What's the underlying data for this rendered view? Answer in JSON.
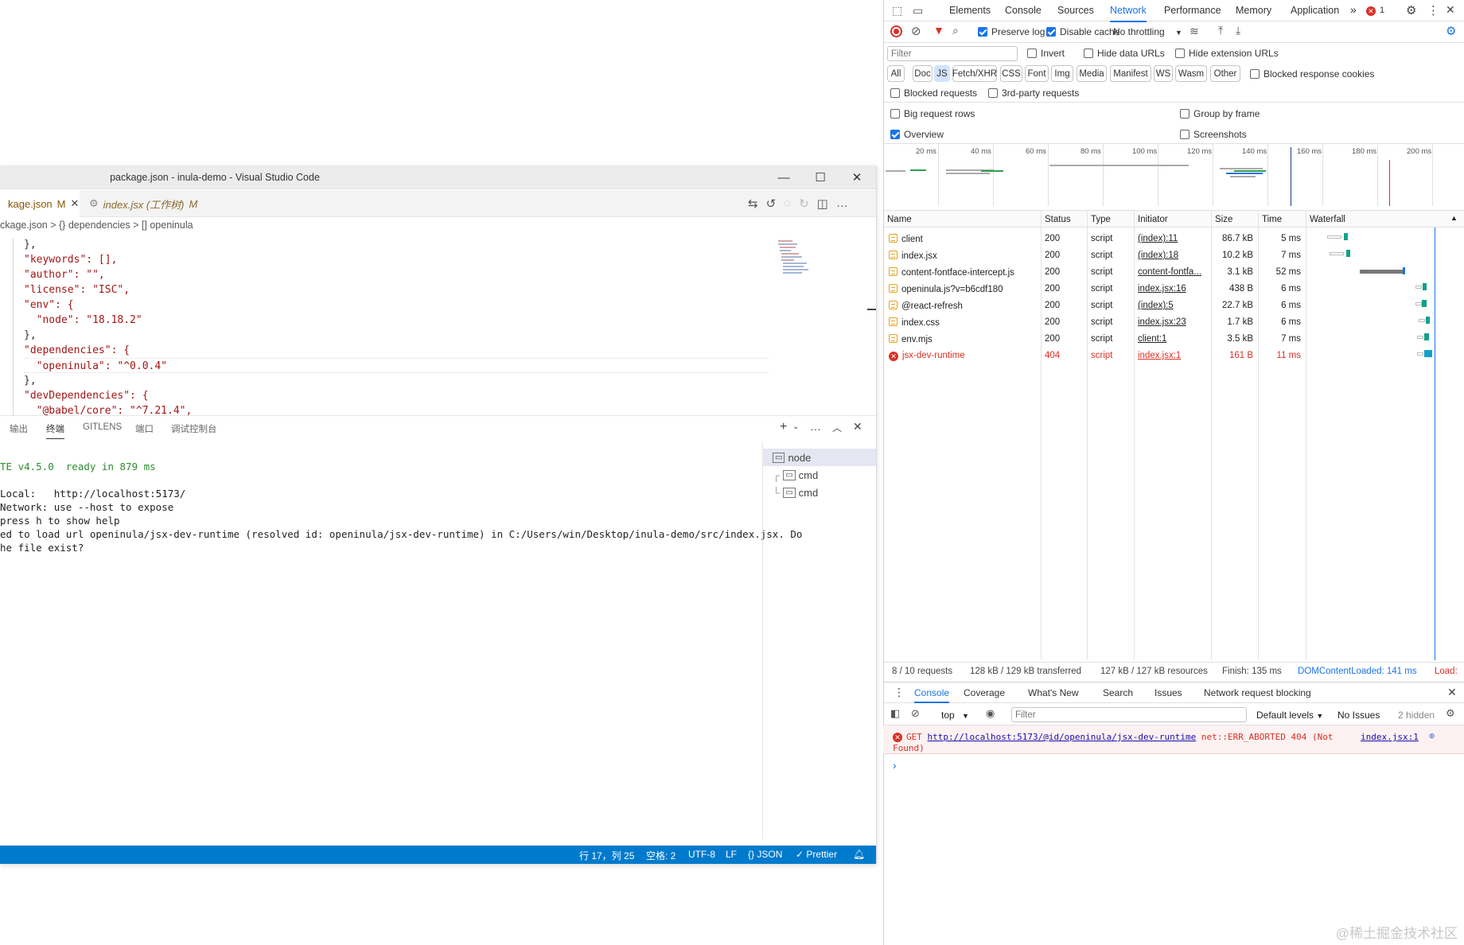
{
  "vscode": {
    "title": "package.json - inula-demo - Visual Studio Code",
    "tabs": [
      {
        "label": "kage.json",
        "badge": "M",
        "active": true
      },
      {
        "label": "index.jsx (工作树)",
        "badge": "M",
        "active": false
      }
    ],
    "breadcrumb": "ckage.json  >  {} dependencies  >  [] openinula",
    "code_lines": [
      "},",
      "\"keywords\": [],",
      "\"author\": \"\",",
      "\"license\": \"ISC\",",
      "\"env\": {",
      "  \"node\": \"18.18.2\"",
      "},",
      "\"dependencies\": {",
      "  \"openinula\": \"^0.0.4\"",
      "},",
      "\"devDependencies\": {",
      "  \"@babel/core\": \"^7.21.4\","
    ],
    "panel_tabs": [
      "输出",
      "终端",
      "GITLENS",
      "端口",
      "调试控制台"
    ],
    "terminal_lines": [
      "TE v4.5.0  ready in 879 ms",
      "",
      "Local:   http://localhost:5173/",
      "Network: use --host to expose",
      "press h to show help",
      "ed to load url openinula/jsx-dev-runtime (resolved id: openinula/jsx-dev-runtime) in C:/Users/win/Desktop/inula-demo/src/index.jsx. Do",
      "he file exist?"
    ],
    "terminal_instances": [
      "node",
      "cmd",
      "cmd"
    ],
    "status_items": [
      "行 17，列 25",
      "空格: 2",
      "UTF-8",
      "LF",
      "{} JSON",
      "✓ Prettier"
    ]
  },
  "devtools": {
    "main_tabs": [
      "Elements",
      "Console",
      "Sources",
      "Network",
      "Performance",
      "Memory",
      "Application"
    ],
    "error_count": "1",
    "toolbar": {
      "preserve_log": "Preserve log",
      "disable_cache": "Disable cache",
      "throttling": "No throttling"
    },
    "filter_placeholder": "Filter",
    "filter_options": [
      "Invert",
      "Hide data URLs",
      "Hide extension URLs"
    ],
    "type_chips": [
      "All",
      "Doc",
      "JS",
      "Fetch/XHR",
      "CSS",
      "Font",
      "Img",
      "Media",
      "Manifest",
      "WS",
      "Wasm",
      "Other"
    ],
    "blocked_cookies": "Blocked response cookies",
    "blocked_requests": "Blocked requests",
    "third_party": "3rd-party requests",
    "big_rows": "Big request rows",
    "group_by_frame": "Group by frame",
    "overview": "Overview",
    "screenshots": "Screenshots",
    "timeline_ticks": [
      "20 ms",
      "40 ms",
      "60 ms",
      "80 ms",
      "100 ms",
      "120 ms",
      "140 ms",
      "160 ms",
      "180 ms",
      "200 ms"
    ],
    "columns": [
      "Name",
      "Status",
      "Type",
      "Initiator",
      "Size",
      "Time",
      "Waterfall"
    ],
    "requests": [
      {
        "name": "client",
        "status": "200",
        "type": "script",
        "initiator": "(index):11",
        "size": "86.7 kB",
        "time": "5 ms",
        "error": false
      },
      {
        "name": "index.jsx",
        "status": "200",
        "type": "script",
        "initiator": "(index):18",
        "size": "10.2 kB",
        "time": "7 ms",
        "error": false
      },
      {
        "name": "content-fontface-intercept.js",
        "status": "200",
        "type": "script",
        "initiator": "content-fontfa...",
        "size": "3.1 kB",
        "time": "52 ms",
        "error": false
      },
      {
        "name": "openinula.js?v=b6cdf180",
        "status": "200",
        "type": "script",
        "initiator": "index.jsx:16",
        "size": "438 B",
        "time": "6 ms",
        "error": false
      },
      {
        "name": "@react-refresh",
        "status": "200",
        "type": "script",
        "initiator": "(index):5",
        "size": "22.7 kB",
        "time": "6 ms",
        "error": false
      },
      {
        "name": "index.css",
        "status": "200",
        "type": "script",
        "initiator": "index.jsx:23",
        "size": "1.7 kB",
        "time": "6 ms",
        "error": false
      },
      {
        "name": "env.mjs",
        "status": "200",
        "type": "script",
        "initiator": "client:1",
        "size": "3.5 kB",
        "time": "7 ms",
        "error": false
      },
      {
        "name": "jsx-dev-runtime",
        "status": "404",
        "type": "script",
        "initiator": "index.jsx:1",
        "size": "161 B",
        "time": "11 ms",
        "error": true
      }
    ],
    "tooltip": "http://localhost:5173/@id/openinula/jsx-dev-runtime",
    "summary": {
      "requests": "8 / 10 requests",
      "transferred": "128 kB / 129 kB transferred",
      "resources": "127 kB / 127 kB resources",
      "finish": "Finish: 135 ms",
      "dom_loaded": "DOMContentLoaded: 141 ms",
      "load": "Load:"
    },
    "drawer_tabs": [
      "Console",
      "Coverage",
      "What's New",
      "Search",
      "Issues",
      "Network request blocking"
    ],
    "console_bar": {
      "context": "top",
      "filter_placeholder": "Filter",
      "levels": "Default levels",
      "issues": "No Issues",
      "hidden": "2 hidden"
    },
    "console_error": {
      "method": "GET",
      "url": "http://localhost:5173/@id/openinula/jsx-dev-runtime",
      "message": "net::ERR_ABORTED 404 (Not",
      "message2": "Found)",
      "source": "index.jsx:1"
    }
  },
  "watermark": "@稀土掘金技术社区",
  "colors": {
    "accent": "#1a73e8",
    "status_bar": "#007acc",
    "error": "#d93025"
  }
}
